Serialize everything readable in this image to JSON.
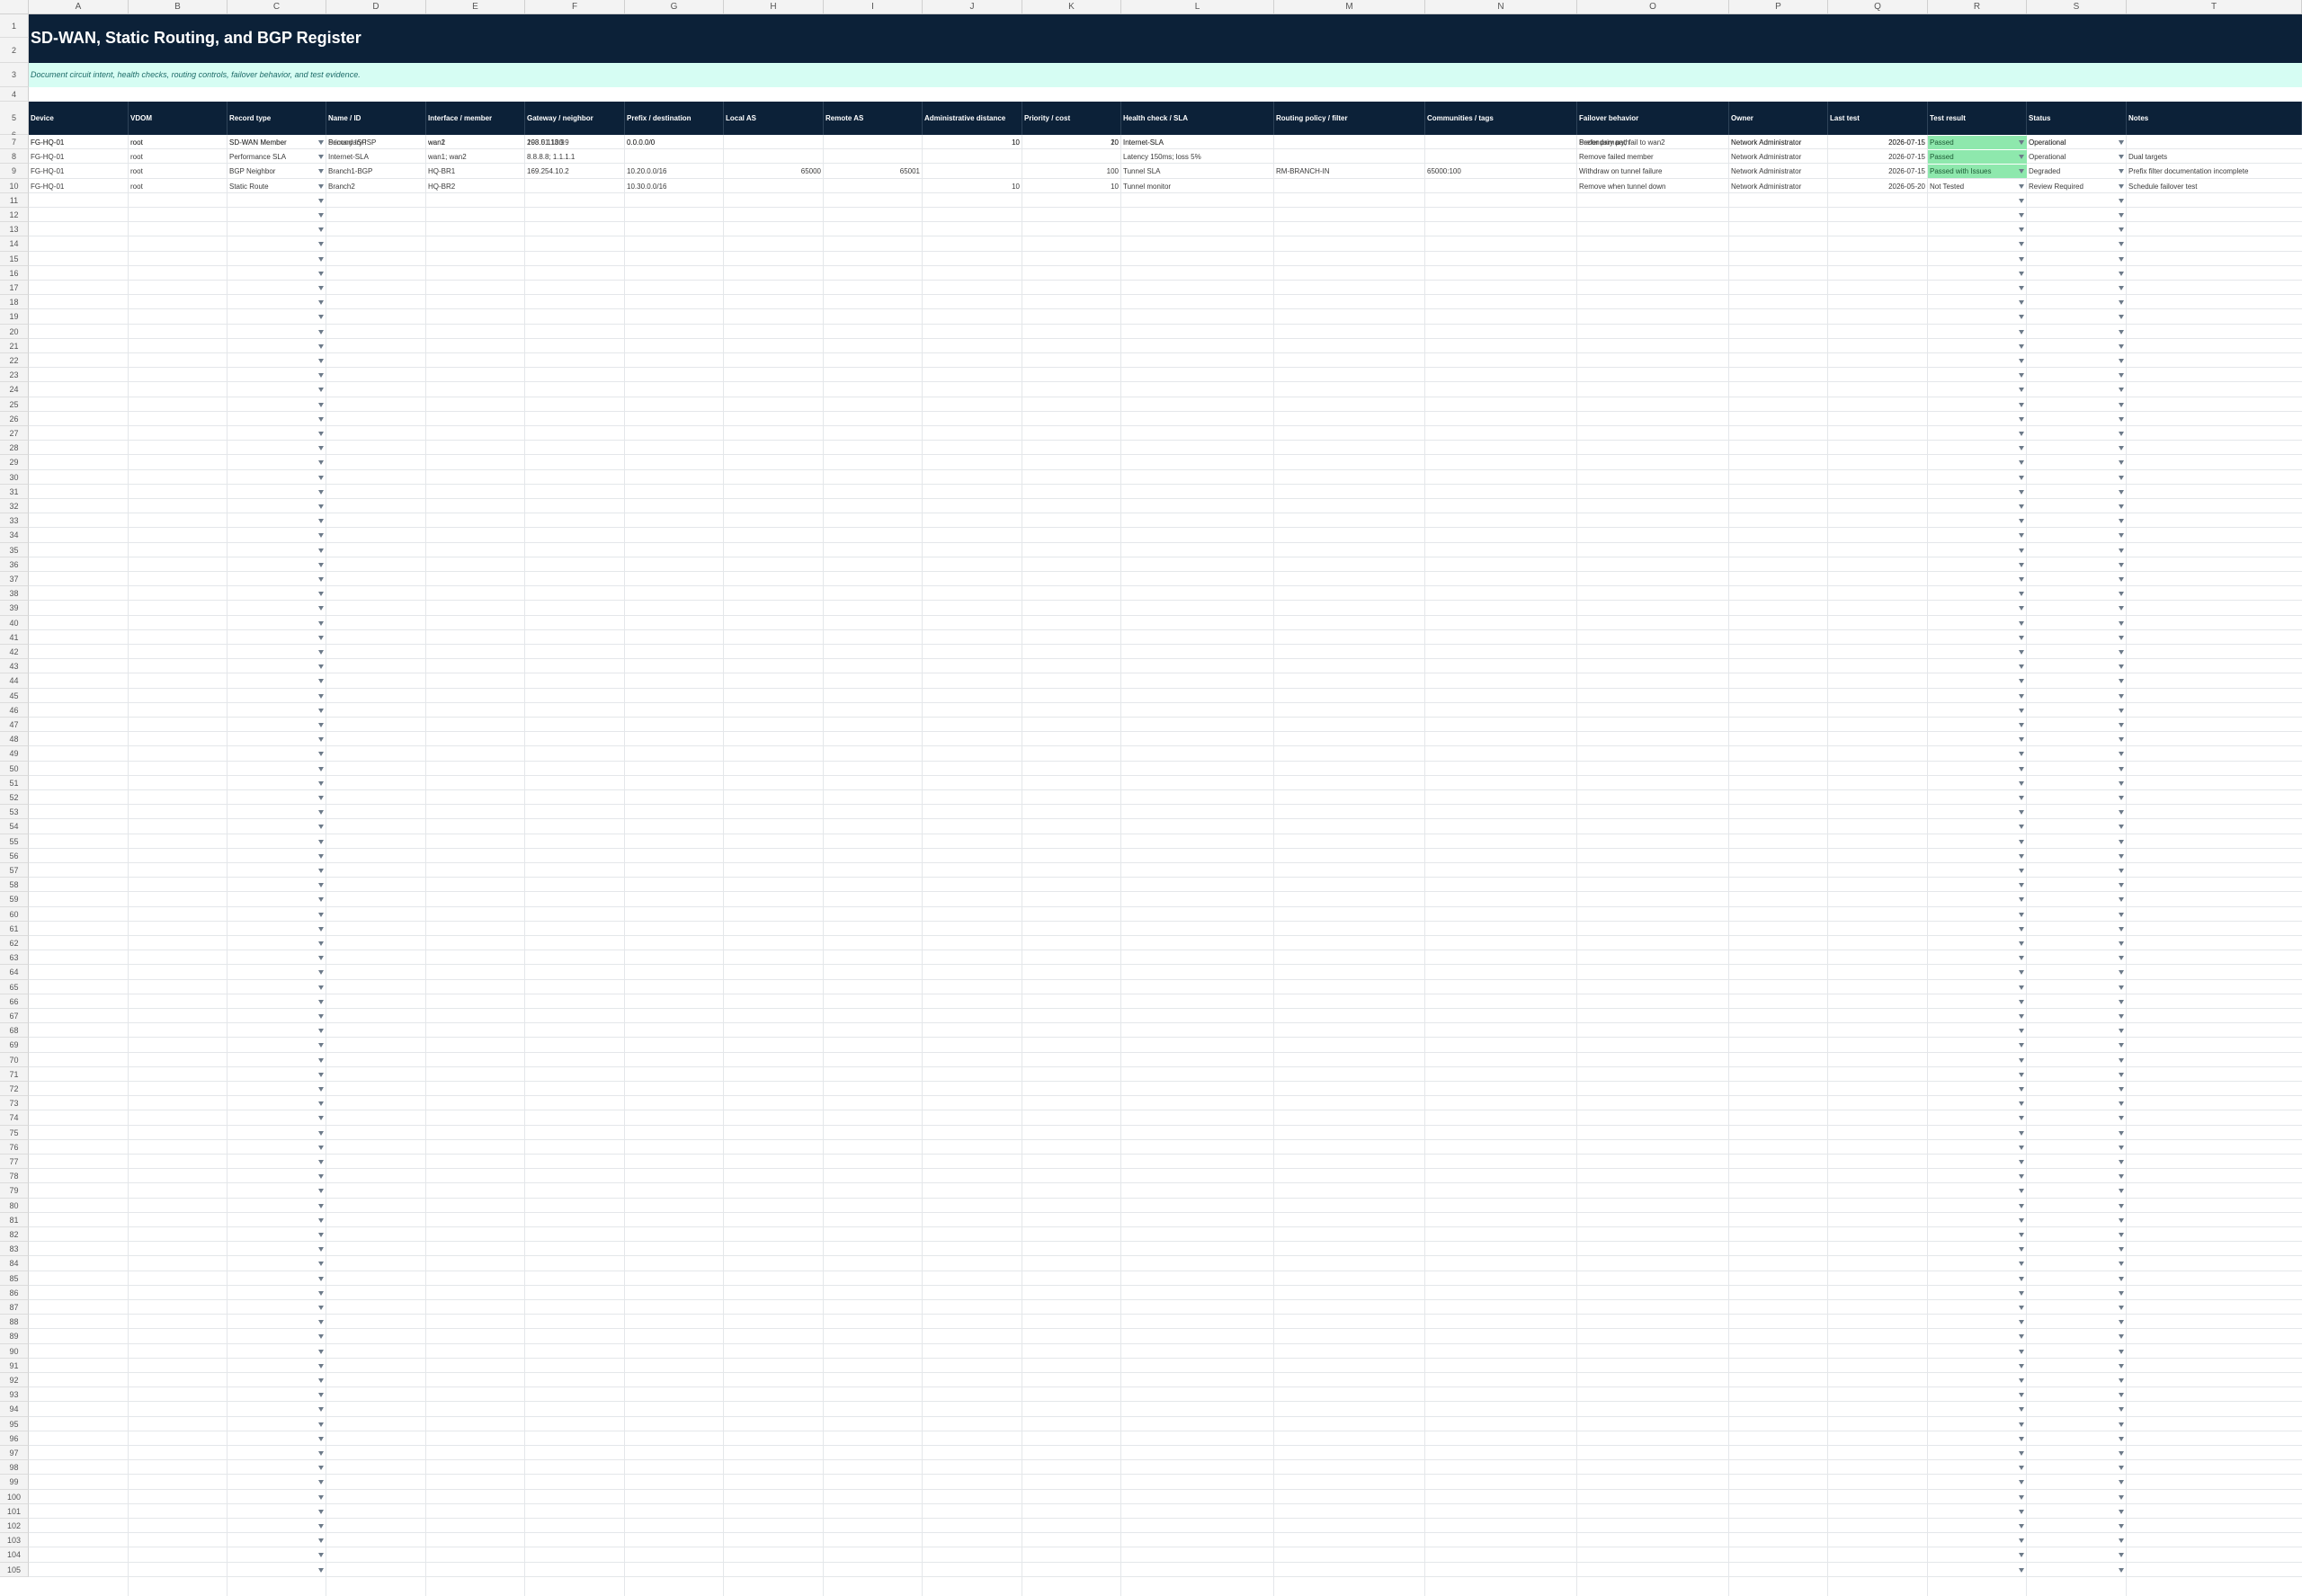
{
  "sheet": {
    "title": "SD-WAN, Static Routing, and BGP Register",
    "subtitle": "Document circuit intent, health checks, routing controls, failover behavior, and test evidence.",
    "column_letters": [
      "A",
      "B",
      "C",
      "D",
      "E",
      "F",
      "G",
      "H",
      "I",
      "J",
      "K",
      "L",
      "M",
      "N",
      "O",
      "P",
      "Q",
      "R",
      "S",
      "T"
    ],
    "headers": [
      "Device",
      "VDOM",
      "Record type",
      "Name / ID",
      "Interface / member",
      "Gateway / neighbor",
      "Prefix / destination",
      "Local AS",
      "Remote AS",
      "Administrative distance",
      "Priority / cost",
      "Health check / SLA",
      "Routing policy / filter",
      "Communities / tags",
      "Failover behavior",
      "Owner",
      "Last test",
      "Test result",
      "Status",
      "Notes"
    ],
    "rows": [
      [
        "FG-HQ-01",
        "root",
        "SD-WAN Member",
        "Primary ISP",
        "wan1",
        "203.0.113.9",
        "0.0.0.0/0",
        "",
        "",
        "10",
        "10",
        "Internet-SLA",
        "",
        "",
        "Prefer primary; fail to wan2",
        "Network Administrator",
        "2026-07-15",
        "Passed",
        "Operational",
        ""
      ],
      [
        "FG-HQ-01",
        "root",
        "SD-WAN Member",
        "Secondary ISP",
        "wan2",
        "198.51.100.9",
        "0.0.0.0/0",
        "",
        "",
        "10",
        "20",
        "Internet-SLA",
        "",
        "",
        "Secondary path",
        "Network Administrator",
        "2026-07-15",
        "Passed",
        "Operational",
        ""
      ],
      [
        "FG-HQ-01",
        "root",
        "Performance SLA",
        "Internet-SLA",
        "wan1; wan2",
        "8.8.8.8; 1.1.1.1",
        "",
        "",
        "",
        "",
        "",
        "Latency 150ms; loss 5%",
        "",
        "",
        "Remove failed member",
        "Network Administrator",
        "2026-07-15",
        "Passed",
        "Operational",
        "Dual targets"
      ],
      [
        "FG-HQ-01",
        "root",
        "BGP Neighbor",
        "Branch1-BGP",
        "HQ-BR1",
        "169.254.10.2",
        "10.20.0.0/16",
        "65000",
        "65001",
        "",
        "100",
        "Tunnel SLA",
        "RM-BRANCH-IN",
        "65000:100",
        "Withdraw on tunnel failure",
        "Network Administrator",
        "2026-07-15",
        "Passed with Issues",
        "Degraded",
        "Prefix filter documentation incomplete"
      ],
      [
        "FG-HQ-01",
        "root",
        "Static Route",
        "Branch2",
        "HQ-BR2",
        "",
        "10.30.0.0/16",
        "",
        "",
        "10",
        "10",
        "Tunnel monitor",
        "",
        "",
        "Remove when tunnel down",
        "Network Administrator",
        "2026-05-20",
        "Not Tested",
        "Review Required",
        "Schedule failover test"
      ]
    ],
    "row_numbers": [
      "1",
      "2",
      "3",
      "4",
      "5",
      "6",
      "7",
      "8",
      "9",
      "10",
      "11",
      "12",
      "13",
      "14",
      "15",
      "16",
      "17",
      "18",
      "19",
      "20",
      "21",
      "22",
      "23",
      "24",
      "25",
      "26",
      "27",
      "28",
      "29",
      "30",
      "31",
      "32",
      "33",
      "34",
      "35",
      "36",
      "37",
      "38",
      "39",
      "40",
      "41",
      "42",
      "43",
      "44",
      "45",
      "46",
      "47",
      "48",
      "49",
      "50",
      "51",
      "52",
      "53",
      "54",
      "55",
      "56",
      "57",
      "58",
      "59",
      "60",
      "61",
      "62",
      "63",
      "64",
      "65",
      "66",
      "67",
      "68",
      "69",
      "70",
      "71",
      "72",
      "73",
      "74",
      "75",
      "76",
      "77",
      "78",
      "79",
      "80",
      "81",
      "82",
      "83",
      "84",
      "85",
      "86",
      "87",
      "88",
      "89",
      "90",
      "91",
      "92",
      "93",
      "94",
      "95",
      "96",
      "97",
      "98",
      "99",
      "100",
      "101",
      "102",
      "103",
      "104",
      "105"
    ],
    "colors": {
      "title_bg": "#0c2138",
      "subtitle_bg": "#d6fdf3",
      "header_bg": "#0c2138",
      "passed_fill": "#8ee8ad"
    },
    "icons": {
      "dropdown": "dropdown-arrow-icon"
    }
  }
}
